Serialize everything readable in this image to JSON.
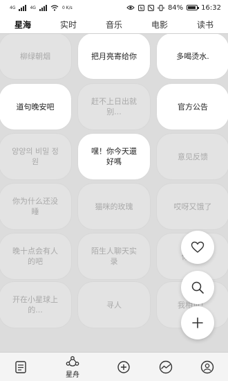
{
  "status_bar": {
    "network_left": "4G",
    "network_right": "4G",
    "speed": "0 K/s",
    "battery": "84%",
    "time": "16:32"
  },
  "tabs": [
    {
      "label": "星海",
      "active": true
    },
    {
      "label": "实时",
      "active": false
    },
    {
      "label": "音乐",
      "active": false
    },
    {
      "label": "电影",
      "active": false
    },
    {
      "label": "读书",
      "active": false
    }
  ],
  "cards": [
    {
      "text": "柳绿朝烟",
      "highlighted": false
    },
    {
      "text": "把月亮寄给你",
      "highlighted": true
    },
    {
      "text": "多喝烫水.",
      "highlighted": true
    },
    {
      "text": "道句晚安吧",
      "highlighted": true
    },
    {
      "text": "赶不上日出就别...",
      "highlighted": false
    },
    {
      "text": "官方公告",
      "highlighted": true
    },
    {
      "text": "양양의 비밀 정원",
      "highlighted": false
    },
    {
      "text": "嘿！你今天還好嗎",
      "highlighted": true
    },
    {
      "text": "意见反馈",
      "highlighted": false
    },
    {
      "text": "你为什么还没睡",
      "highlighted": false
    },
    {
      "text": "猫咪的玫瑰",
      "highlighted": false
    },
    {
      "text": "哎呀又饿了",
      "highlighted": false
    },
    {
      "text": "晚十点会有人的吧",
      "highlighted": false
    },
    {
      "text": "陌生人聊天实录",
      "highlighted": false
    },
    {
      "text": "你走...",
      "highlighted": false
    },
    {
      "text": "开在小星球上的...",
      "highlighted": false
    },
    {
      "text": "寻人",
      "highlighted": false
    },
    {
      "text": "我相见！",
      "highlighted": false
    }
  ],
  "fabs": [
    {
      "icon": "heart-icon"
    },
    {
      "icon": "search-icon"
    },
    {
      "icon": "plus-icon"
    }
  ],
  "bottom_nav": [
    {
      "icon": "notebook-icon",
      "label": ""
    },
    {
      "icon": "boat-icon",
      "label": "星舟"
    },
    {
      "icon": "plus-circle-icon",
      "label": ""
    },
    {
      "icon": "trend-circle-icon",
      "label": ""
    },
    {
      "icon": "user-circle-icon",
      "label": ""
    }
  ]
}
